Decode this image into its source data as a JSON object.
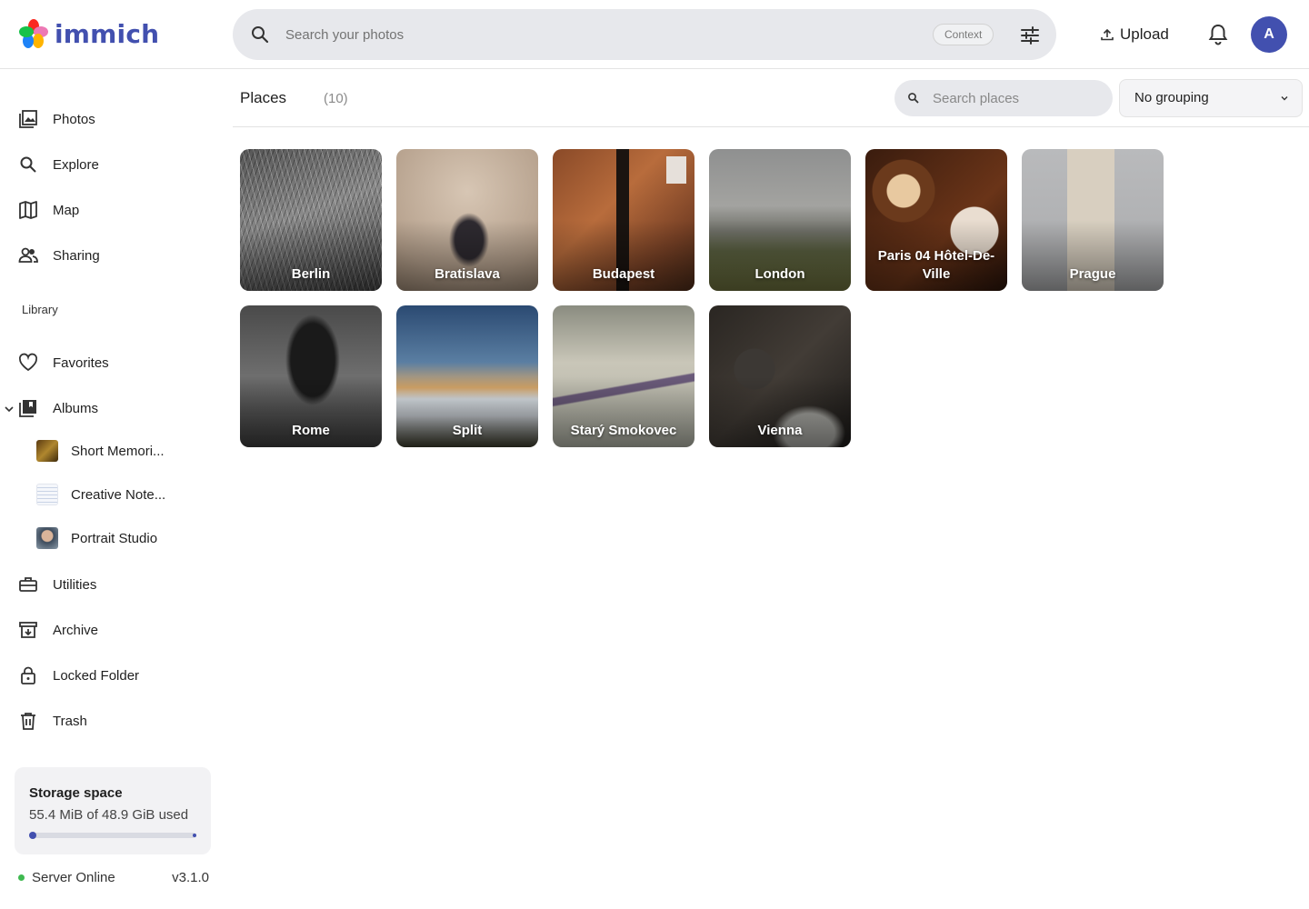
{
  "app": {
    "name": "immich"
  },
  "search": {
    "placeholder": "Search your photos",
    "context_label": "Context"
  },
  "header": {
    "upload_label": "Upload",
    "avatar_initial": "A"
  },
  "sidebar": {
    "items": [
      {
        "label": "Photos",
        "icon": "photos-icon"
      },
      {
        "label": "Explore",
        "icon": "search-icon"
      },
      {
        "label": "Map",
        "icon": "map-icon"
      },
      {
        "label": "Sharing",
        "icon": "people-icon"
      }
    ],
    "library_label": "Library",
    "library_items": [
      {
        "label": "Favorites",
        "icon": "heart-icon"
      },
      {
        "label": "Albums",
        "icon": "album-icon"
      }
    ],
    "albums": [
      {
        "label": "Short Memori..."
      },
      {
        "label": "Creative Note..."
      },
      {
        "label": "Portrait Studio"
      }
    ],
    "tools": [
      {
        "label": "Utilities",
        "icon": "toolbox-icon"
      },
      {
        "label": "Archive",
        "icon": "archive-icon"
      },
      {
        "label": "Locked Folder",
        "icon": "lock-icon"
      },
      {
        "label": "Trash",
        "icon": "trash-icon"
      }
    ]
  },
  "storage": {
    "title": "Storage space",
    "used": "55.4 MiB of 48.9 GiB used",
    "fraction": 0.001
  },
  "server": {
    "status": "Server Online",
    "version": "v3.1.0"
  },
  "main": {
    "title": "Places",
    "count": "(10)",
    "search_placeholder": "Search places",
    "grouping": "No grouping",
    "places": [
      {
        "name": "Berlin"
      },
      {
        "name": "Bratislava"
      },
      {
        "name": "Budapest"
      },
      {
        "name": "London"
      },
      {
        "name": "Paris 04 Hôtel-De-Ville"
      },
      {
        "name": "Prague"
      },
      {
        "name": "Rome"
      },
      {
        "name": "Split"
      },
      {
        "name": "Starý Smokovec"
      },
      {
        "name": "Vienna"
      }
    ]
  },
  "colors": {
    "accent": "#4250af",
    "online": "#3fb950"
  }
}
